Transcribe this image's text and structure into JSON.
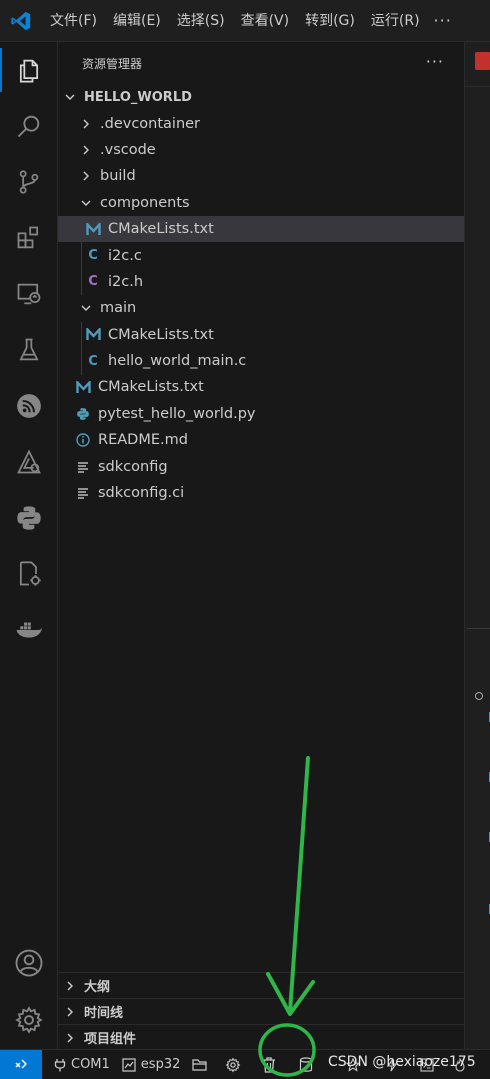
{
  "menu": {
    "items": [
      "文件(F)",
      "编辑(E)",
      "选择(S)",
      "查看(V)",
      "转到(G)",
      "运行(R)"
    ],
    "more": "···"
  },
  "sidebar": {
    "title": "资源管理器",
    "actions": "···",
    "tree": [
      {
        "label": "HELLO_WORLD",
        "type": "root",
        "depth": 0,
        "chevron": "down"
      },
      {
        "label": ".devcontainer",
        "type": "folder",
        "depth": 1,
        "chevron": "right"
      },
      {
        "label": ".vscode",
        "type": "folder",
        "depth": 1,
        "chevron": "right"
      },
      {
        "label": "build",
        "type": "folder",
        "depth": 1,
        "chevron": "right"
      },
      {
        "label": "components",
        "type": "folder",
        "depth": 1,
        "chevron": "down"
      },
      {
        "label": "CMakeLists.txt",
        "type": "cmake",
        "depth": 2,
        "selected": true
      },
      {
        "label": "i2c.c",
        "type": "c",
        "depth": 2
      },
      {
        "label": "i2c.h",
        "type": "h",
        "depth": 2
      },
      {
        "label": "main",
        "type": "folder",
        "depth": 1,
        "chevron": "down"
      },
      {
        "label": "CMakeLists.txt",
        "type": "cmake",
        "depth": 2
      },
      {
        "label": "hello_world_main.c",
        "type": "c",
        "depth": 2
      },
      {
        "label": "CMakeLists.txt",
        "type": "cmake",
        "depth": 1
      },
      {
        "label": "pytest_hello_world.py",
        "type": "python",
        "depth": 1
      },
      {
        "label": "README.md",
        "type": "info",
        "depth": 1
      },
      {
        "label": "sdkconfig",
        "type": "config",
        "depth": 1
      },
      {
        "label": "sdkconfig.ci",
        "type": "config",
        "depth": 1
      }
    ],
    "panels": [
      "大纲",
      "时间线",
      "项目组件"
    ]
  },
  "status": {
    "port": "COM1",
    "target": "esp32",
    "watermark": "CSDN @hexiaoze175"
  },
  "colors": {
    "accent": "#0078d4",
    "cmake": "#519aba",
    "c": "#519aba",
    "h": "#a074c4",
    "annotation": "#2fb64a"
  }
}
